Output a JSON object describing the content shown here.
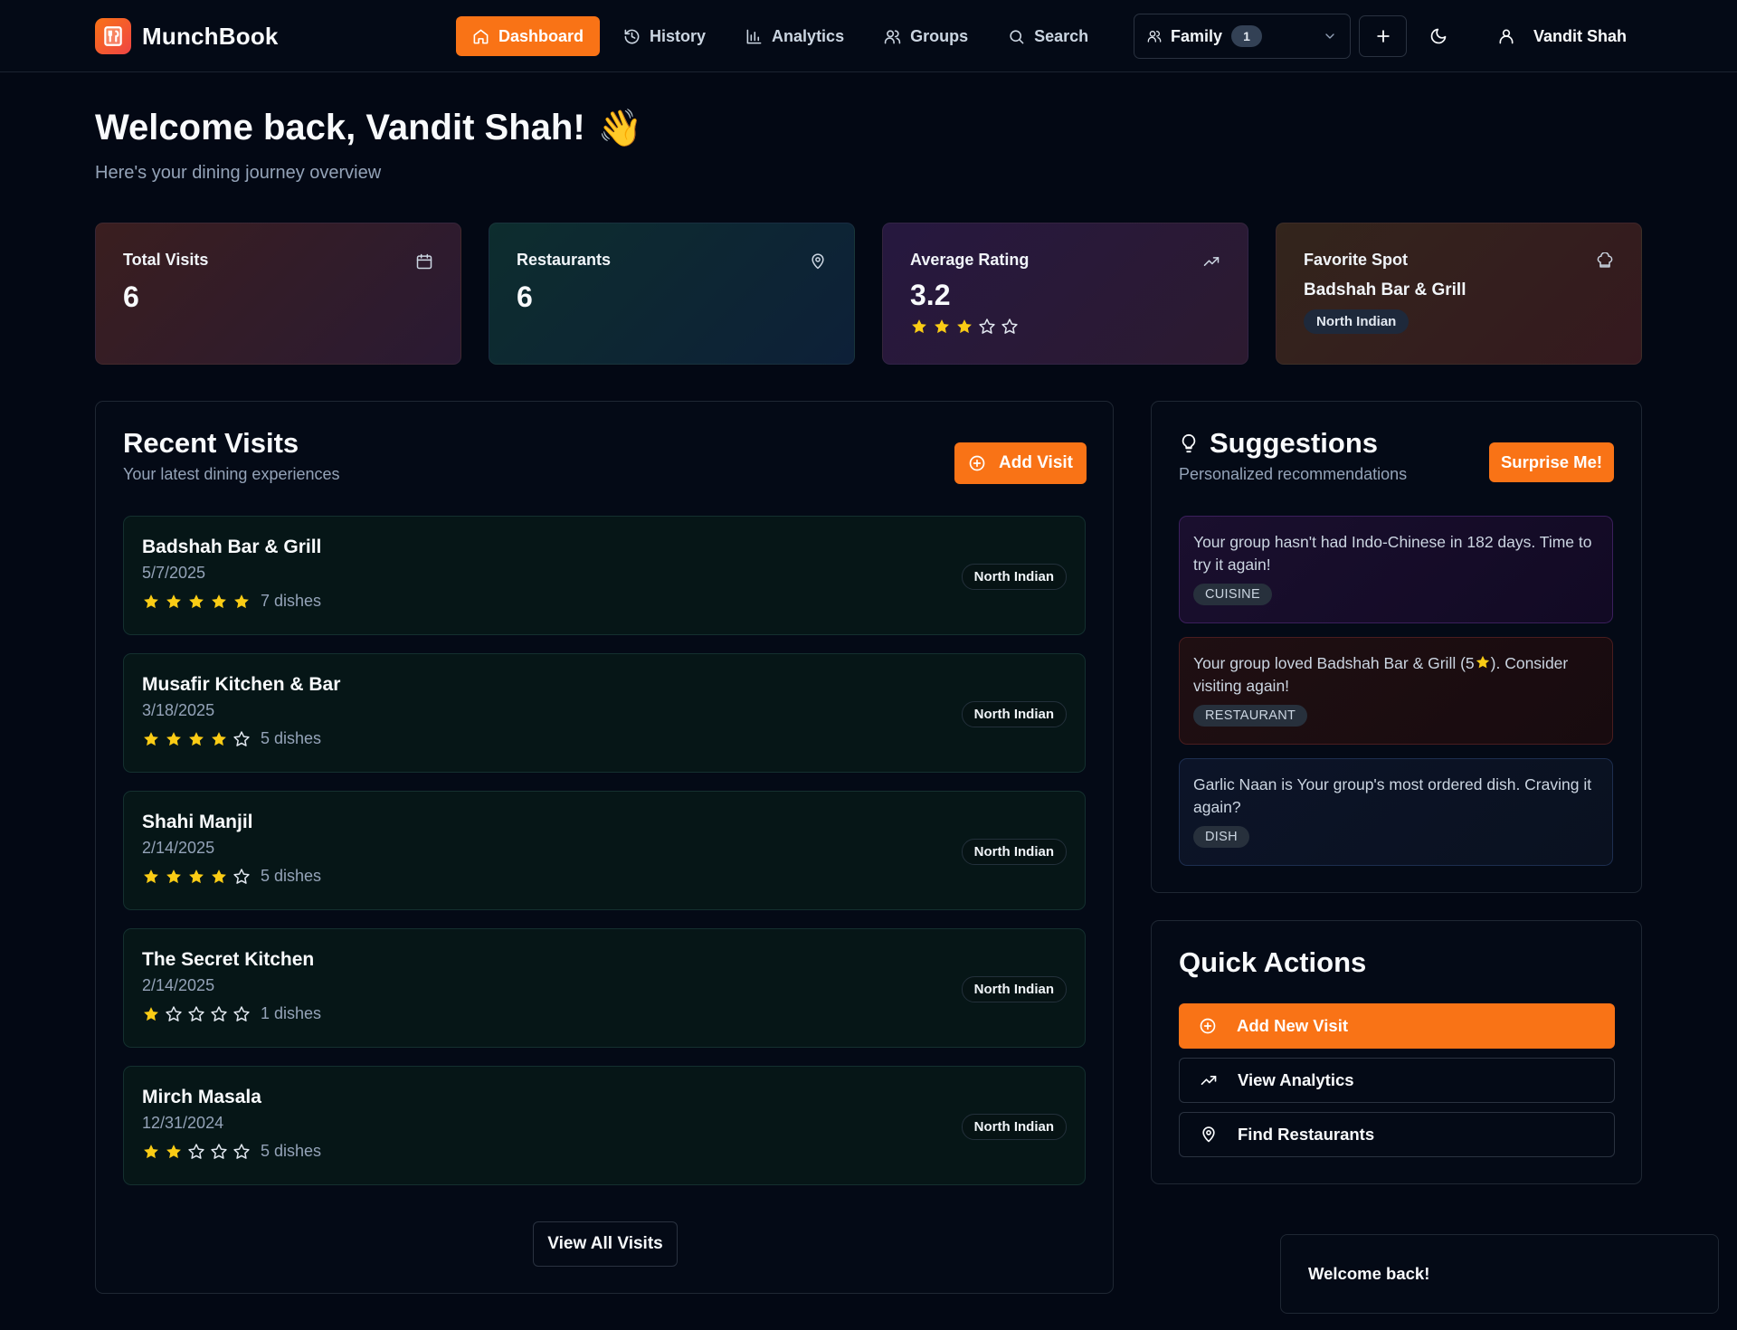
{
  "app": {
    "name": "MunchBook"
  },
  "nav": {
    "dashboard": "Dashboard",
    "history": "History",
    "analytics": "Analytics",
    "groups": "Groups",
    "search": "Search"
  },
  "group_selector": {
    "value": "Family",
    "count": "1"
  },
  "user": {
    "name": "Vandit Shah"
  },
  "welcome": {
    "title": "Welcome back, Vandit Shah!",
    "emoji": "👋",
    "subtitle": "Here's your dining journey overview"
  },
  "stats": {
    "total_visits": {
      "label": "Total Visits",
      "value": "6"
    },
    "restaurants": {
      "label": "Restaurants",
      "value": "6"
    },
    "average_rating": {
      "label": "Average Rating",
      "value": "3.2",
      "stars_filled": 3,
      "stars_total": 5
    },
    "favorite_spot": {
      "label": "Favorite Spot",
      "name": "Badshah Bar & Grill",
      "cuisine": "North Indian"
    }
  },
  "recent_visits": {
    "title": "Recent Visits",
    "subtitle": "Your latest dining experiences",
    "add_label": "Add Visit",
    "view_all_label": "View All Visits",
    "items": [
      {
        "name": "Badshah Bar & Grill",
        "date": "5/7/2025",
        "rating": 5,
        "dishes": "7 dishes",
        "cuisine": "North Indian"
      },
      {
        "name": "Musafir Kitchen & Bar",
        "date": "3/18/2025",
        "rating": 4,
        "dishes": "5 dishes",
        "cuisine": "North Indian"
      },
      {
        "name": "Shahi Manjil",
        "date": "2/14/2025",
        "rating": 4,
        "dishes": "5 dishes",
        "cuisine": "North Indian"
      },
      {
        "name": "The Secret Kitchen",
        "date": "2/14/2025",
        "rating": 1,
        "dishes": "1 dishes",
        "cuisine": "North Indian"
      },
      {
        "name": "Mirch Masala",
        "date": "12/31/2024",
        "rating": 2,
        "dishes": "5 dishes",
        "cuisine": "North Indian"
      }
    ]
  },
  "suggestions": {
    "title": "Suggestions",
    "subtitle": "Personalized recommendations",
    "surprise_label": "Surprise Me!",
    "items": [
      {
        "text": "Your group hasn't had Indo-Chinese in 182 days. Time to try it again!",
        "tag": "CUISINE"
      },
      {
        "text_before": "Your group loved Badshah Bar & Grill (5",
        "text_after": "). Consider visiting again!",
        "tag": "RESTAURANT"
      },
      {
        "text": "Garlic Naan is Your group's most ordered dish. Craving it again?",
        "tag": "DISH"
      }
    ]
  },
  "quick_actions": {
    "title": "Quick Actions",
    "add_new_visit": "Add New Visit",
    "view_analytics": "View Analytics",
    "find_restaurants": "Find Restaurants"
  },
  "toast": {
    "message": "Welcome back!"
  },
  "colors": {
    "accent": "#f97316",
    "star": "#facc15",
    "star_empty": "#e2e8f0",
    "background": "#030814"
  }
}
